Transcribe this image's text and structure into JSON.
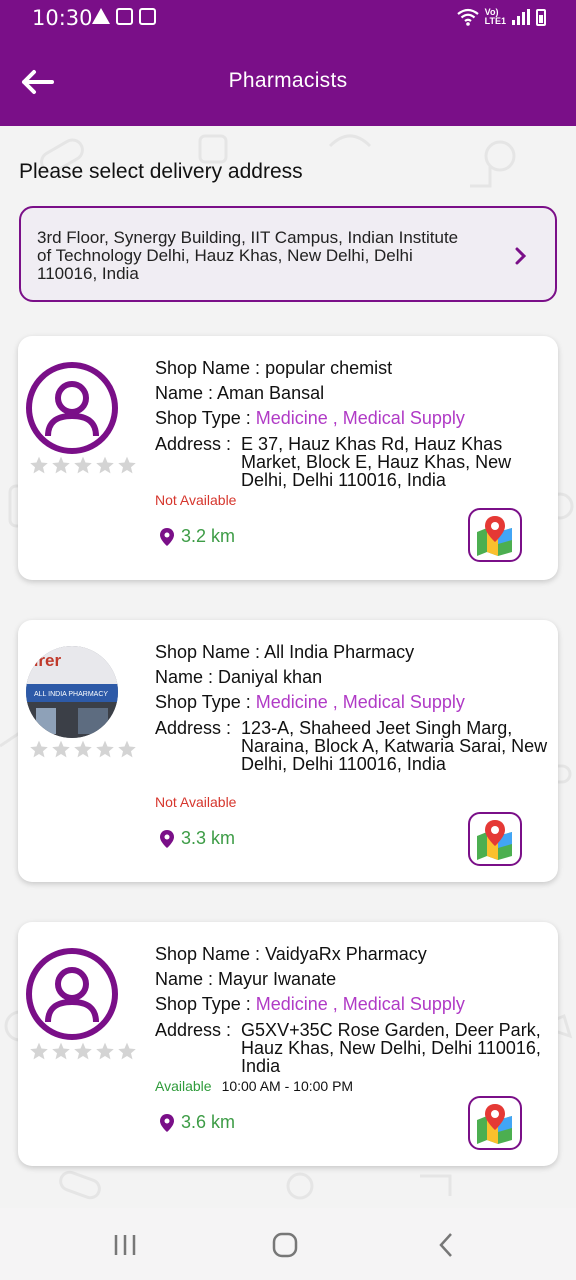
{
  "status_bar": {
    "time": "10:30",
    "network_label_top": "Vo)",
    "network_label_bottom": "LTE1"
  },
  "header": {
    "title": "Pharmacists"
  },
  "delivery": {
    "heading": "Please select delivery address",
    "address": "3rd Floor, Synergy Building, IIT Campus, Indian Institute of Technology Delhi, Hauz Khas, New Delhi, Delhi 110016, India"
  },
  "labels": {
    "shop_name": "Shop Name : ",
    "name": "Name : ",
    "shop_type": "Shop Type : ",
    "address": "Address : "
  },
  "pharmacists": [
    {
      "shop_name": "popular chemist",
      "name": "Aman Bansal",
      "shop_type": "Medicine , Medical Supply",
      "address": "E 37, Hauz Khas Rd, Hauz Khas Market, Block E, Hauz Khas, New Delhi, Delhi 110016, India",
      "availability": "Not Available",
      "hours": "",
      "distance": "3.2 km",
      "rating": 0,
      "avatar": "user-placeholder-icon"
    },
    {
      "shop_name": "All India Pharmacy",
      "name": "Daniyal khan",
      "shop_type": "Medicine , Medical Supply",
      "address": "123-A, Shaheed Jeet Singh Marg, Naraina, Block A, Katwaria Sarai, New Delhi, Delhi 110016, India",
      "availability": "Not Available",
      "hours": "",
      "distance": "3.3 km",
      "rating": 0,
      "avatar": "shop-photo",
      "avatar_sign_text": "urer",
      "avatar_board_text": "ALL INDIA PHARMACY"
    },
    {
      "shop_name": "VaidyaRx Pharmacy",
      "name": "Mayur Iwanate",
      "shop_type": "Medicine , Medical Supply",
      "address": "G5XV+35C Rose Garden, Deer Park, Hauz Khas, New Delhi, Delhi 110016, India",
      "availability": "Available",
      "hours": "10:00 AM - 10:00 PM",
      "distance": "3.6 km",
      "rating": 0,
      "avatar": "user-placeholder-icon"
    }
  ],
  "colors": {
    "brand": "#7a0f88",
    "accent_text": "#b03ac6",
    "unavailable": "#d6362d",
    "available": "#2e9b3a",
    "star_empty": "#d4d4d4"
  }
}
